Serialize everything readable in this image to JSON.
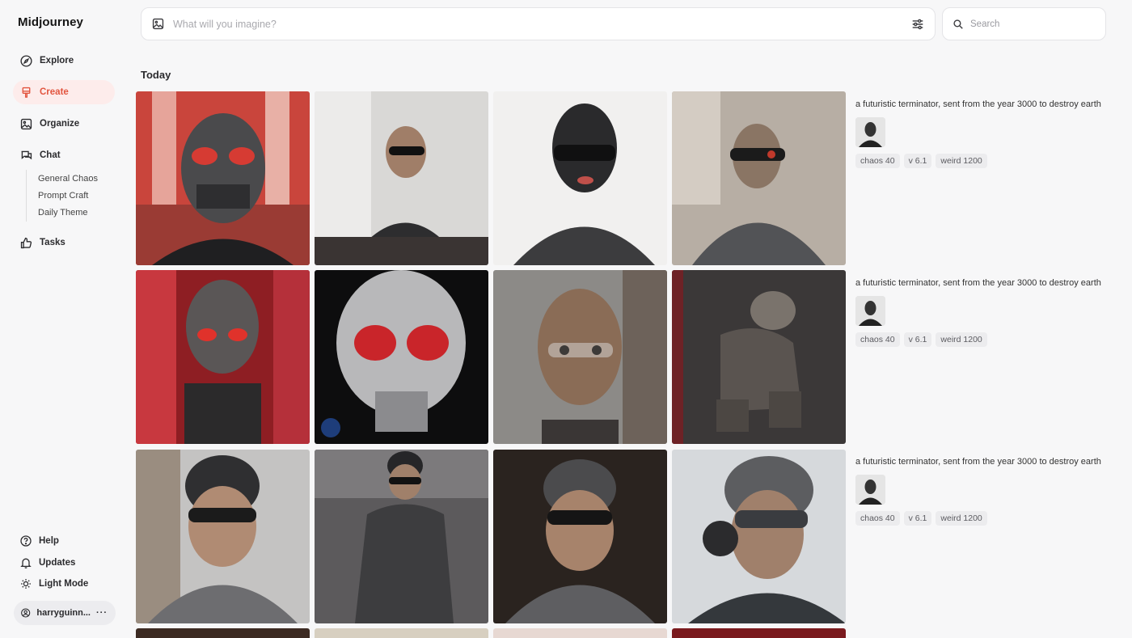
{
  "app": {
    "name": "Midjourney"
  },
  "sidebar": {
    "items": [
      {
        "label": "Explore",
        "icon": "compass-icon"
      },
      {
        "label": "Create",
        "icon": "brush-icon",
        "active": true
      },
      {
        "label": "Organize",
        "icon": "image-icon"
      },
      {
        "label": "Chat",
        "icon": "chat-icon"
      },
      {
        "label": "Tasks",
        "icon": "thumbs-up-icon"
      }
    ],
    "chat_rooms": [
      "General Chaos",
      "Prompt Craft",
      "Daily Theme"
    ],
    "footer": [
      {
        "label": "Help",
        "icon": "help-icon"
      },
      {
        "label": "Updates",
        "icon": "bell-icon"
      },
      {
        "label": "Light Mode",
        "icon": "sun-icon"
      }
    ],
    "user": {
      "name": "harryguinn...",
      "menu": "···"
    }
  },
  "prompt_bar": {
    "placeholder": "What will you imagine?"
  },
  "search": {
    "placeholder": "Search"
  },
  "section": {
    "title": "Today"
  },
  "jobs": [
    {
      "prompt": "a futuristic terminator, sent from the year 3000 to destroy earth",
      "chips": [
        "chaos 40",
        "v 6.1",
        "weird 1200"
      ]
    },
    {
      "prompt": "a futuristic terminator, sent from the year 3000 to destroy earth",
      "chips": [
        "chaos 40",
        "v 6.1",
        "weird 1200"
      ]
    },
    {
      "prompt": "a futuristic terminator, sent from the year 3000 to destroy earth",
      "chips": [
        "chaos 40",
        "v 6.1",
        "weird 1200"
      ]
    }
  ],
  "colors": {
    "accent": "#e2553f",
    "active_bg": "#fdeceb",
    "page_bg": "#f7f7f8"
  }
}
